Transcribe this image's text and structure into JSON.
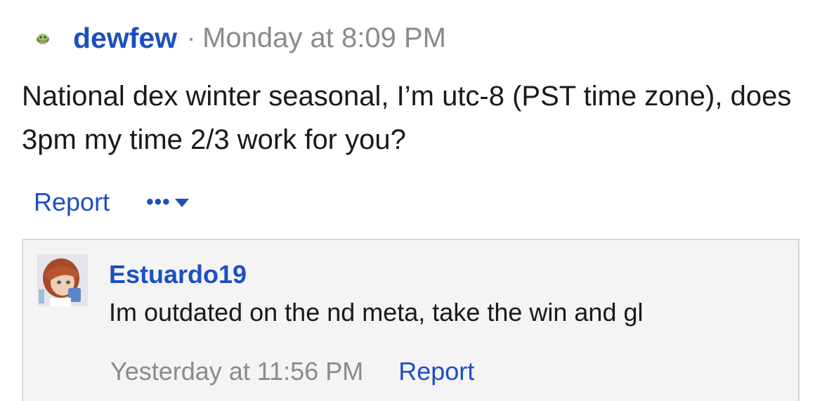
{
  "post": {
    "username": "dewfew",
    "separator": "·",
    "timestamp": "Monday at 8:09 PM",
    "body": "National dex winter seasonal, I’m utc-8 (PST time zone), does 3pm my time 2/3 work for you?",
    "actions": {
      "report_label": "Report",
      "more_label": "•••"
    }
  },
  "comment": {
    "username": "Estuardo19",
    "text": "Im outdated on the nd meta, take the win and gl",
    "timestamp": "Yesterday at 11:56 PM",
    "report_label": "Report"
  },
  "icons": {
    "post_avatar": "pokemon-sprite-icon",
    "more_caret": "caret-down-icon",
    "comment_avatar": "anime-character-avatar"
  },
  "colors": {
    "link": "#1c4fc2",
    "muted": "#8a8a8a",
    "text": "#1a1a1a",
    "comment_bg": "#f4f4f4",
    "comment_border": "#d8d8d8"
  }
}
